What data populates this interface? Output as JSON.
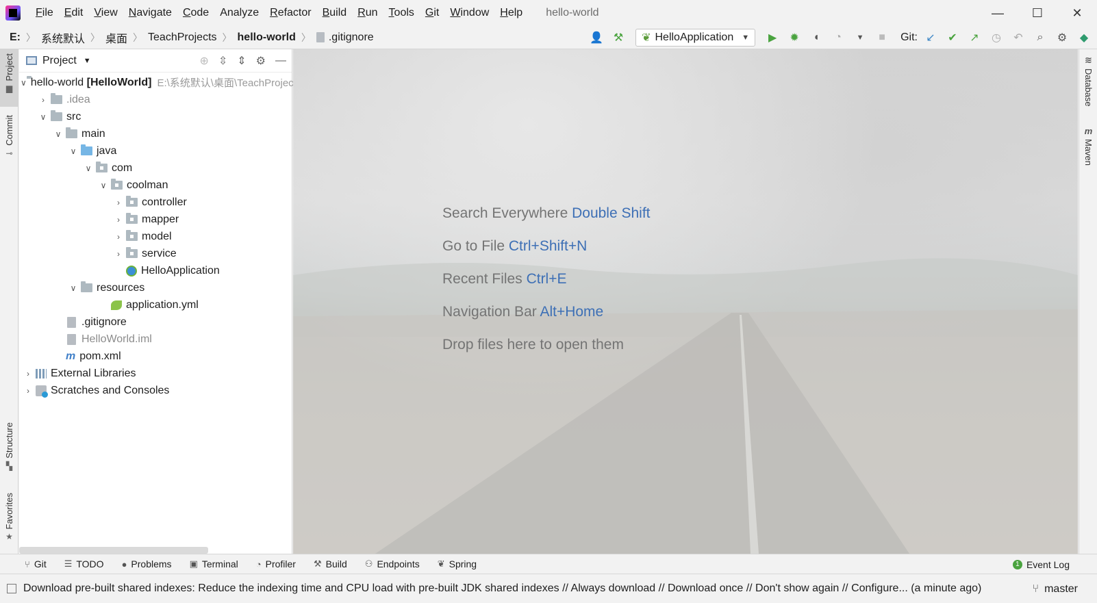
{
  "window": {
    "title": "hello-world",
    "controls": {
      "minimize": "—",
      "maximize": "☐",
      "close": "✕"
    }
  },
  "menu": [
    {
      "label": "File",
      "mnemonic": "F",
      "rest": "ile"
    },
    {
      "label": "Edit",
      "mnemonic": "E",
      "rest": "dit"
    },
    {
      "label": "View",
      "mnemonic": "V",
      "rest": "iew"
    },
    {
      "label": "Navigate",
      "mnemonic": "N",
      "rest": "avigate"
    },
    {
      "label": "Code",
      "mnemonic": "C",
      "rest": "ode"
    },
    {
      "label": "Analyze",
      "mnemonic": "",
      "rest": "Analyze"
    },
    {
      "label": "Refactor",
      "mnemonic": "R",
      "rest": "efactor"
    },
    {
      "label": "Build",
      "mnemonic": "B",
      "rest": "uild"
    },
    {
      "label": "Run",
      "mnemonic": "R",
      "rest": "un"
    },
    {
      "label": "Tools",
      "mnemonic": "T",
      "rest": "ools"
    },
    {
      "label": "Git",
      "mnemonic": "G",
      "rest": "it"
    },
    {
      "label": "Window",
      "mnemonic": "W",
      "rest": "indow"
    },
    {
      "label": "Help",
      "mnemonic": "H",
      "rest": "elp"
    }
  ],
  "breadcrumbs": [
    "E:",
    "系统默认",
    "桌面",
    "TeachProjects",
    "hello-world",
    ".gitignore"
  ],
  "toolbar": {
    "run_config": "HelloApplication",
    "git_label": "Git:"
  },
  "project_panel": {
    "title": "Project",
    "tree": {
      "root_name": "hello-world",
      "root_module": "[HelloWorld]",
      "root_path": "E:\\系统默认\\桌面\\TeachProjects\\hello-world",
      "idea": ".idea",
      "src": "src",
      "main": "main",
      "java": "java",
      "com": "com",
      "coolman": "coolman",
      "controller": "controller",
      "mapper": "mapper",
      "model": "model",
      "service": "service",
      "hello_app": "HelloApplication",
      "resources": "resources",
      "app_yml": "application.yml",
      "gitignore": ".gitignore",
      "iml": "HelloWorld.iml",
      "pom": "pom.xml",
      "ext_libs": "External Libraries",
      "scratches": "Scratches and Consoles"
    }
  },
  "left_tabs": {
    "project": "Project",
    "commit": "Commit",
    "structure": "Structure",
    "favorites": "Favorites"
  },
  "right_tabs": {
    "database": "Database",
    "maven": "Maven"
  },
  "welcome_hints": [
    {
      "text": "Search Everywhere",
      "key": "Double Shift"
    },
    {
      "text": "Go to File",
      "key": "Ctrl+Shift+N"
    },
    {
      "text": "Recent Files",
      "key": "Ctrl+E"
    },
    {
      "text": "Navigation Bar",
      "key": "Alt+Home"
    },
    {
      "text": "Drop files here to open them",
      "key": ""
    }
  ],
  "bottom_tabs": [
    "Git",
    "TODO",
    "Problems",
    "Terminal",
    "Profiler",
    "Build",
    "Endpoints",
    "Spring"
  ],
  "event_log": "Event Log",
  "status": {
    "message": "Download pre-built shared indexes: Reduce the indexing time and CPU load with pre-built JDK shared indexes // Always download // Download once // Don't show again // Configure... (a minute ago)",
    "branch": "master"
  },
  "colors": {
    "accent_blue": "#3d6fb5",
    "run_green": "#4aa33f"
  }
}
